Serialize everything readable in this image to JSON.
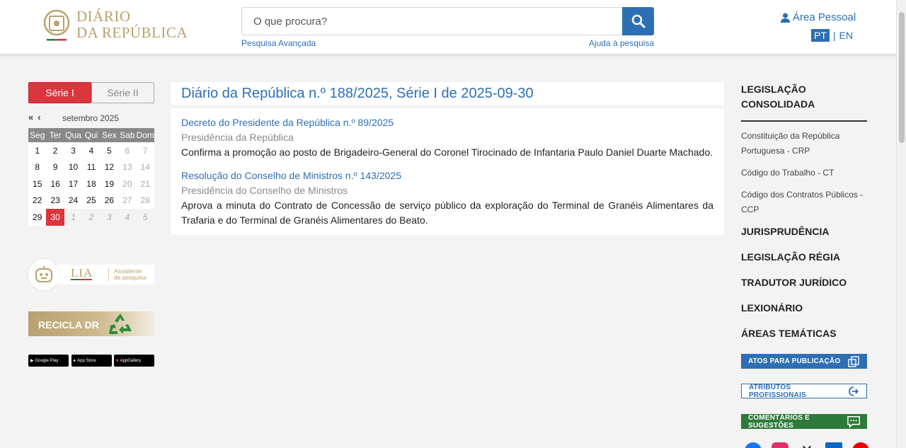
{
  "header": {
    "logo_line1": "DIÁRIO",
    "logo_line2": "DA REPÚBLICA",
    "search_placeholder": "O que procura?",
    "advanced_search": "Pesquisa Avançada",
    "search_help": "Ajuda à pesquisa",
    "personal_area": "Área Pessoal",
    "lang_pt": "PT",
    "lang_sep": "|",
    "lang_en": "EN"
  },
  "sidebar_left": {
    "series_tabs": [
      "Série I",
      "Série II"
    ],
    "calendar": {
      "month_label": "setembro  2025",
      "weekdays": [
        "Seg",
        "Ter",
        "Qua",
        "Qui",
        "Sex",
        "Sab",
        "Dom"
      ],
      "weeks": [
        [
          "1",
          "2",
          "3",
          "4",
          "5",
          "6",
          "7"
        ],
        [
          "8",
          "9",
          "10",
          "11",
          "12",
          "13",
          "14"
        ],
        [
          "15",
          "16",
          "17",
          "18",
          "19",
          "20",
          "21"
        ],
        [
          "22",
          "23",
          "24",
          "25",
          "26",
          "27",
          "28"
        ],
        [
          "29",
          "30",
          "1",
          "2",
          "3",
          "4",
          "5"
        ]
      ],
      "selected_day": "30"
    },
    "lia": {
      "name": "LIA",
      "subtitle_line1": "Assistente",
      "subtitle_line2": "de pesquisa"
    },
    "recicla": "RECICLA DR",
    "stores": [
      "Google Play",
      "App Store",
      "AppGallery"
    ]
  },
  "main": {
    "title": "Diário da República n.º 188/2025, Série I de 2025-09-30",
    "items": [
      {
        "title": "Decreto do Presidente da República n.º 89/2025",
        "issuer": "Presidência da República",
        "summary": "Confirma a promoção ao posto de Brigadeiro-General do Coronel Tirocinado de Infantaria Paulo Daniel Duarte Machado."
      },
      {
        "title": "Resolução do Conselho de Ministros n.º 143/2025",
        "issuer": "Presidência do Conselho de Ministros",
        "summary": "Aprova a minuta do Contrato de Concessão de serviço público da exploração do Terminal de Granéis Alimentares da Trafaria e do Terminal de Granéis Alimentares do Beato."
      }
    ]
  },
  "sidebar_right": {
    "consolidated_title": "LEGISLAÇÃO CONSOLIDADA",
    "consolidated_links": [
      "Constituição da República Portuguesa - CRP",
      "Código do Trabalho - CT",
      "Código dos Contratos Públicos - CCP"
    ],
    "sections": [
      "JURISPRUDÊNCIA",
      "LEGISLAÇÃO RÉGIA",
      "TRADUTOR JURÍDICO",
      "LEXIONÁRIO",
      "ÁREAS TEMÁTICAS"
    ],
    "buttons": {
      "atos": "ATOS PARA PUBLICAÇÃO",
      "atributos": "ATRIBUTOS PROFISSIONAIS",
      "comentarios": "COMENTÁRIOS E SUGESTÕES"
    },
    "socials": [
      "facebook-icon",
      "instagram-icon",
      "x-icon",
      "linkedin-icon",
      "youtube-icon"
    ]
  },
  "colors": {
    "primary_blue": "#2d6fb4",
    "accent_red": "#d9363e",
    "gold": "#b9a16b",
    "green": "#2d7a3a"
  }
}
